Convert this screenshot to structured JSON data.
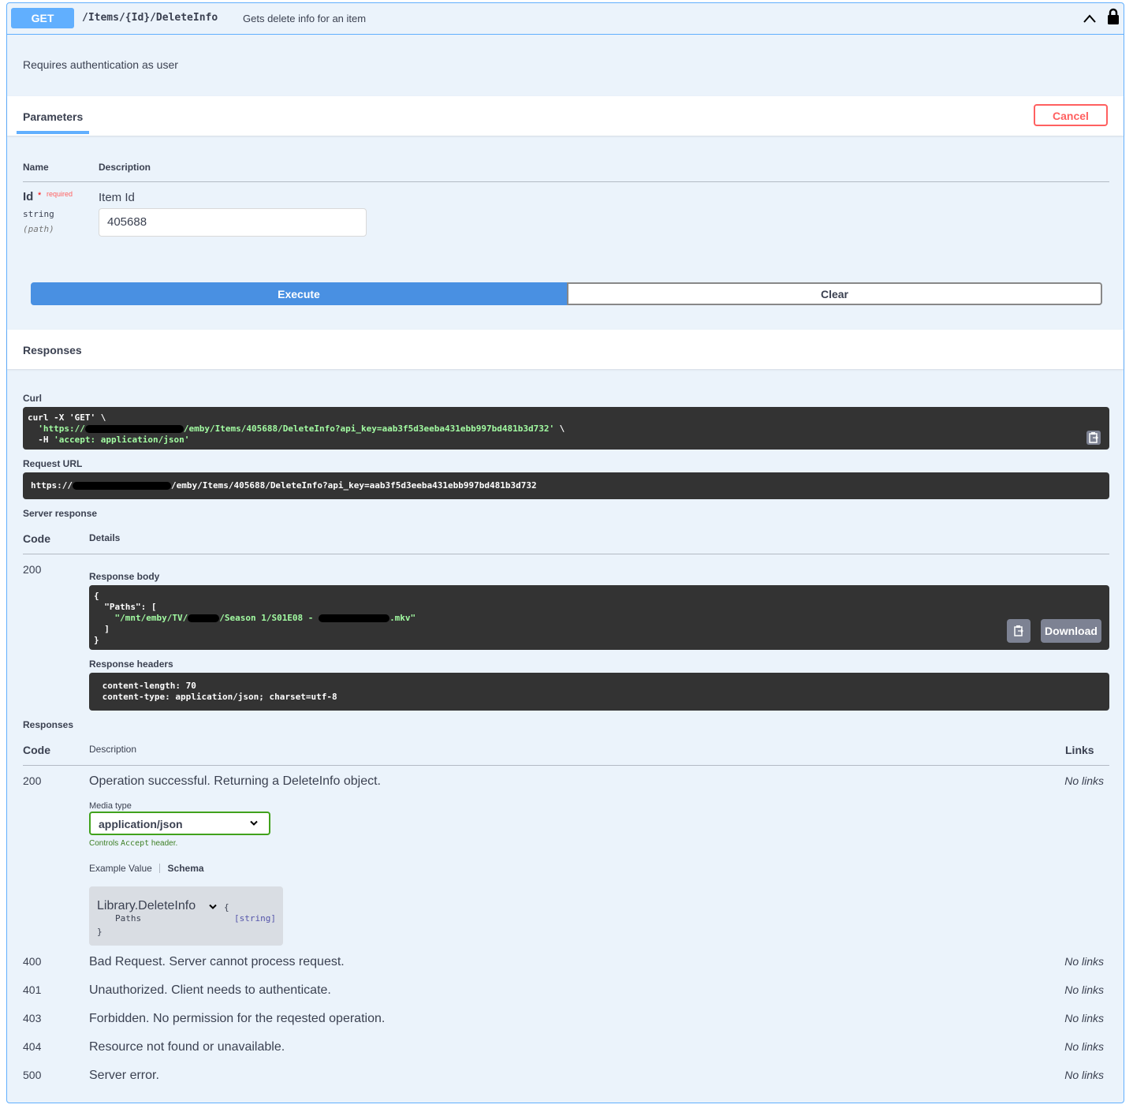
{
  "summary": {
    "method": "GET",
    "path": "/Items/{Id}/DeleteInfo",
    "description": "Gets delete info for an item"
  },
  "description": "Requires authentication as user",
  "parameters": {
    "title": "Parameters",
    "cancel_label": "Cancel",
    "col_name": "Name",
    "col_description": "Description",
    "items": [
      {
        "name": "Id",
        "required_star": "*",
        "required_text": "required",
        "type": "string",
        "location": "(path)",
        "description": "Item Id",
        "value": "405688"
      }
    ]
  },
  "actions": {
    "execute": "Execute",
    "clear": "Clear"
  },
  "responses_section": {
    "title": "Responses",
    "curl_label": "Curl",
    "curl_line1": "curl -X 'GET' \\",
    "curl_line2_prefix": "  'https://",
    "curl_line2_suffix": "/emby/Items/405688/DeleteInfo?api_key=aab3f5d3eeba431ebb997bd481b3d732'",
    "curl_line2_tail": " \\",
    "curl_line3_prefix": "  -H ",
    "curl_line3_str": "'accept: application/json'",
    "request_url_label": "Request URL",
    "request_url_prefix": "https://",
    "request_url_suffix": "/emby/Items/405688/DeleteInfo?api_key=aab3f5d3eeba431ebb997bd481b3d732",
    "server_response_label": "Server response",
    "col_code": "Code",
    "col_details": "Details",
    "code": "200",
    "response_body_label": "Response body",
    "body_line1": "{",
    "body_line2": "  \"Paths\": [",
    "body_line3_prefix": "    \"/mnt/emby/TV/",
    "body_line3_mid": "/Season 1/S01E08 - ",
    "body_line3_suffix": ".mkv\"",
    "body_line4": "  ]",
    "body_line5": "}",
    "download_label": "Download",
    "response_headers_label": "Response headers",
    "header_line1": " content-length: 70 ",
    "header_line2": " content-type: application/json; charset=utf-8 "
  },
  "documented": {
    "title": "Responses",
    "col_code": "Code",
    "col_description": "Description",
    "col_links": "Links",
    "media_type_label": "Media type",
    "media_type_value": "application/json",
    "controls_prefix": "Controls ",
    "controls_code": "Accept",
    "controls_suffix": " header.",
    "example_tab": "Example Value",
    "schema_tab": "Schema",
    "schema_name": "Library.DeleteInfo",
    "schema_open": "{",
    "schema_field": "Paths",
    "schema_field_type": "[string]",
    "schema_close": "}",
    "rows": [
      {
        "code": "200",
        "description": "Operation successful. Returning a DeleteInfo object.",
        "links": "No links"
      },
      {
        "code": "400",
        "description": "Bad Request. Server cannot process request.",
        "links": "No links"
      },
      {
        "code": "401",
        "description": "Unauthorized. Client needs to authenticate.",
        "links": "No links"
      },
      {
        "code": "403",
        "description": "Forbidden. No permission for the reqested operation.",
        "links": "No links"
      },
      {
        "code": "404",
        "description": "Resource not found or unavailable.",
        "links": "No links"
      },
      {
        "code": "500",
        "description": "Server error.",
        "links": "No links"
      }
    ]
  },
  "colors": {
    "method": "#61affe",
    "execute": "#4990e2",
    "cancel": "#ff6060",
    "code_bg": "#333333",
    "string": "#a2fca2"
  }
}
